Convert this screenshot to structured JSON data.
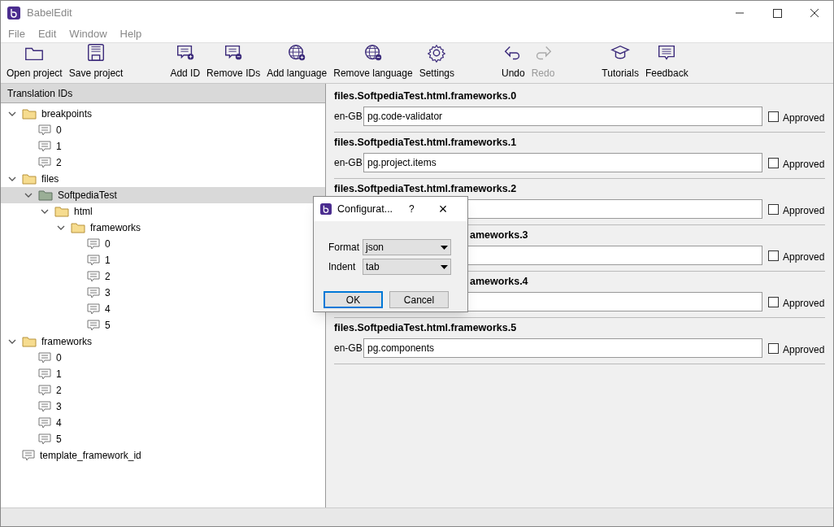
{
  "window": {
    "title": "BabelEdit"
  },
  "menu": [
    "File",
    "Edit",
    "Window",
    "Help"
  ],
  "toolbar": [
    [
      {
        "label": "Open project",
        "disabled": false
      },
      {
        "label": "Save project",
        "disabled": false
      }
    ],
    [
      {
        "label": "Add ID",
        "disabled": false
      },
      {
        "label": "Remove IDs",
        "disabled": false
      },
      {
        "label": "Add language",
        "disabled": false
      },
      {
        "label": "Remove language",
        "disabled": false
      },
      {
        "label": "Settings",
        "disabled": false
      }
    ],
    [
      {
        "label": "Undo",
        "disabled": false
      },
      {
        "label": "Redo",
        "disabled": true
      }
    ],
    [
      {
        "label": "Tutorials",
        "disabled": false
      },
      {
        "label": "Feedback",
        "disabled": false
      }
    ]
  ],
  "tree": {
    "header": "Translation IDs",
    "items": [
      {
        "label": "breakpoints",
        "kind": "folder",
        "expanded": true,
        "selected": false,
        "children": [
          {
            "label": "0",
            "kind": "id",
            "selected": false
          },
          {
            "label": "1",
            "kind": "id",
            "selected": false
          },
          {
            "label": "2",
            "kind": "id",
            "selected": false
          }
        ]
      },
      {
        "label": "files",
        "kind": "folder",
        "expanded": true,
        "selected": false,
        "children": [
          {
            "label": "SoftpediaTest",
            "kind": "folder",
            "expanded": true,
            "selected": true,
            "children": [
              {
                "label": "html",
                "kind": "folder",
                "expanded": true,
                "selected": false,
                "children": [
                  {
                    "label": "frameworks",
                    "kind": "folder",
                    "expanded": true,
                    "selected": false,
                    "children": [
                      {
                        "label": "0",
                        "kind": "id",
                        "selected": false
                      },
                      {
                        "label": "1",
                        "kind": "id",
                        "selected": false
                      },
                      {
                        "label": "2",
                        "kind": "id",
                        "selected": false
                      },
                      {
                        "label": "3",
                        "kind": "id",
                        "selected": false
                      },
                      {
                        "label": "4",
                        "kind": "id",
                        "selected": false
                      },
                      {
                        "label": "5",
                        "kind": "id",
                        "selected": false
                      }
                    ]
                  }
                ]
              }
            ]
          }
        ]
      },
      {
        "label": "frameworks",
        "kind": "folder",
        "expanded": true,
        "selected": false,
        "children": [
          {
            "label": "0",
            "kind": "id",
            "selected": false
          },
          {
            "label": "1",
            "kind": "id",
            "selected": false
          },
          {
            "label": "2",
            "kind": "id",
            "selected": false
          },
          {
            "label": "3",
            "kind": "id",
            "selected": false
          },
          {
            "label": "4",
            "kind": "id",
            "selected": false
          },
          {
            "label": "5",
            "kind": "id",
            "selected": false
          }
        ]
      },
      {
        "label": "template_framework_id",
        "kind": "id",
        "selected": false
      }
    ]
  },
  "entries": [
    {
      "title": "files.SoftpediaTest.html.frameworks.0",
      "language": "en-GB",
      "value": "pg.code-validator",
      "approved": false,
      "approved_label": "Approved"
    },
    {
      "title": "files.SoftpediaTest.html.frameworks.1",
      "language": "en-GB",
      "value": "pg.project.items",
      "approved": false,
      "approved_label": "Approved"
    },
    {
      "title": "files.SoftpediaTest.html.frameworks.2",
      "approved": false,
      "approved_label": "Approved"
    },
    {
      "title": "ameworks.3",
      "approved": false,
      "approved_label": "Approved"
    },
    {
      "title": "ameworks.4",
      "approved": false,
      "approved_label": "Approved"
    },
    {
      "title": "files.SoftpediaTest.html.frameworks.5",
      "language": "en-GB",
      "value": "pg.components",
      "approved": false,
      "approved_label": "Approved"
    }
  ],
  "dialog": {
    "title": "Configurat...",
    "help": "?",
    "close": "×",
    "fields": [
      {
        "label": "Format",
        "value": "json"
      },
      {
        "label": "Indent",
        "value": "tab"
      }
    ],
    "buttons": [
      {
        "label": "OK",
        "selected": true
      },
      {
        "label": "Cancel",
        "selected": false
      }
    ]
  }
}
